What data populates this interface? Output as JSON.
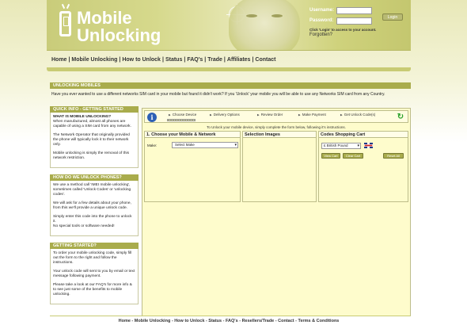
{
  "header": {
    "logo_line1": "Mobile",
    "logo_line2": "Unlocking",
    "login": {
      "username_label": "Username:",
      "password_label": "Password:",
      "button_label": "Login",
      "hint": "Click 'Login' to access to your account.",
      "forgot": "Forgotten?"
    }
  },
  "nav": {
    "items": [
      "Home",
      "Mobile Unlocking",
      "How to Unlock",
      "Status",
      "FAQ's",
      "Trade",
      "Affiliates",
      "Contact"
    ]
  },
  "intro": {
    "heading": "UNLOCKING MOBILES",
    "text": "Have you ever wanted to use a different networks SIM card in your mobile but found it didn't work? If you 'Unlock' your mobile you will be able to use any Networks SIM card from any Country."
  },
  "sidebar": {
    "box1": {
      "heading": "QUICK INFO - GETTING STARTED",
      "strong": "WHAT IS MOBILE UNLOCKING?",
      "p1": "When manufactured, almost all phones are capable of using a SIM card from any network.",
      "p2": "The Network Operator that originally provided the phone will typically lock it to their network only.",
      "p3": "Mobile unlocking is simply the removal of this network restriction."
    },
    "box2": {
      "heading": "HOW DO WE UNLOCK PHONES?",
      "p1": "We use a method call 'IMEI mobile unlocking', sometimes called 'Unlock Codes' or 'unlocking codes'.",
      "p2": "We will ask for a few details about your phone, from this we'll provide a unique unlock code.",
      "p3a": "Simply enter this code into the phone to unlock it.",
      "p3b": "No special tools or software needed!"
    },
    "box3": {
      "heading": "GETTING STARTED?",
      "p1": "To order your mobile unlocking code, simply fill out the form to the right and follow the instructions.",
      "p2": "Your unlock code will sent to you by email or text message following payment.",
      "p3": "Please take a look at our FAQ's for more info & to see just some of the benefits to mobile unlocking."
    }
  },
  "main": {
    "steps": [
      "Choose Device",
      "Delivery Options",
      "Review Order",
      "Make Payment",
      "Get Unlock Code(s)"
    ],
    "progress_step": 1,
    "unlock_text": "To Unlock your mobile device, simply complete the form below, following it's instructions.",
    "panel1": {
      "title": "1. Choose your Mobile & Network",
      "make_label": "Make:",
      "make_value": "Select Make"
    },
    "panel2": {
      "title": "Selection Images"
    },
    "panel3": {
      "title": "Codes Shopping Cart",
      "currency": "£ British Pound",
      "view_cart": "View Cart",
      "clear_cart": "Clear Cart",
      "reset_all": "Reset All"
    }
  },
  "footer": {
    "items": [
      "Home",
      "Mobile Unlocking",
      "How to Unlock",
      "Status",
      "FAQ's",
      "Resellers/Trade",
      "Contact",
      "Terms & Conditions"
    ]
  },
  "colors": {
    "olive_bar": "#a9ac4c",
    "header_band": "#c9cc7a",
    "panel_bg": "#fefccc",
    "info_blue": "#2d60b5",
    "refresh_green": "#2aa22a"
  },
  "icons": [
    "phone-logo-icon",
    "info-icon",
    "refresh-icon",
    "uk-flag-icon"
  ]
}
